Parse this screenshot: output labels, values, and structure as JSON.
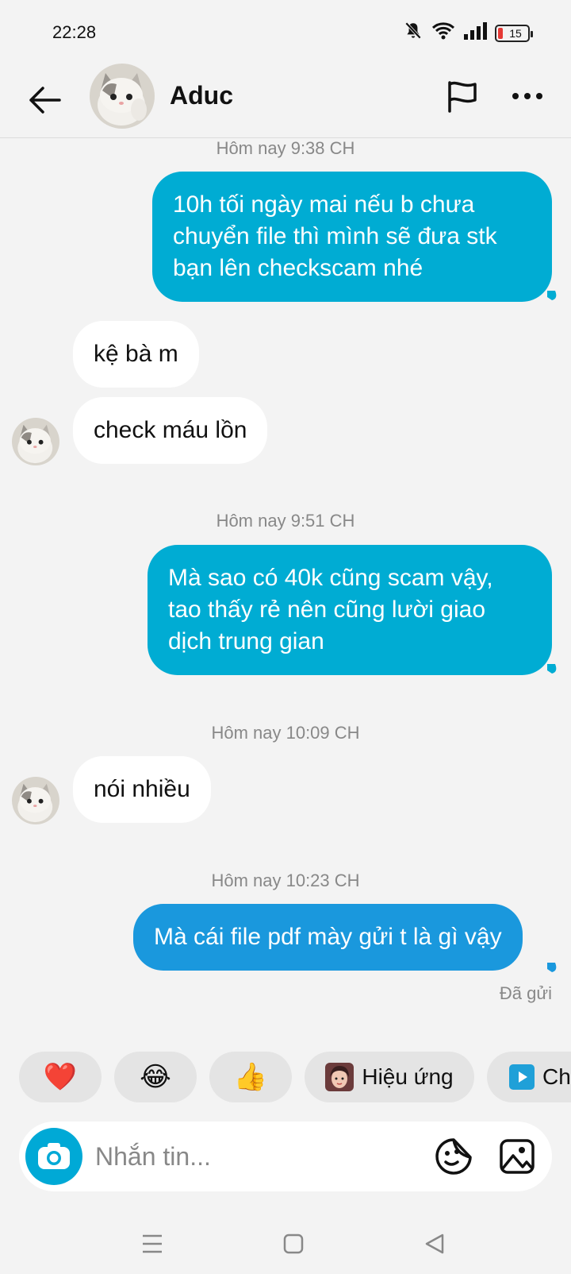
{
  "status_bar": {
    "time": "22:28",
    "battery": "15"
  },
  "header": {
    "contact_name": "Aduc"
  },
  "messages": [
    {
      "timestamp": "Hôm nay 9:38 CH"
    },
    {
      "direction": "out",
      "text": "10h tối ngày mai nếu b chưa chuyển file thì mình sẽ đưa stk bạn lên checkscam nhé"
    },
    {
      "direction": "in",
      "text": "kệ bà m"
    },
    {
      "direction": "in",
      "text": "check máu lồn"
    },
    {
      "timestamp": "Hôm nay 9:51 CH"
    },
    {
      "direction": "out",
      "text": "Mà sao có 40k cũng scam vậy, tao thấy rẻ nên cũng lười giao dịch trung gian"
    },
    {
      "timestamp": "Hôm nay 10:09 CH"
    },
    {
      "direction": "in",
      "text": "nói nhiều"
    },
    {
      "timestamp": "Hôm nay 10:23 CH"
    },
    {
      "direction": "out",
      "text": "Mà cái file pdf mày gửi t là gì vậy"
    },
    {
      "status": "Đã gửi"
    }
  ],
  "quick_reactions": [
    {
      "emoji": "❤️",
      "icon": "heart-icon"
    },
    {
      "emoji": "😂",
      "icon": "laughing-face-icon"
    },
    {
      "emoji": "👍",
      "icon": "thumbs-up-icon"
    },
    {
      "label": "Hiệu ứng",
      "icon": "effects-avatar-icon"
    },
    {
      "label": "Ch",
      "icon": "play-icon"
    }
  ],
  "composer": {
    "placeholder": "Nhắn tin..."
  },
  "colors": {
    "outgoing_bubble": "#00acd3",
    "outgoing_bubble_last": "#1a98dd",
    "incoming_bubble": "#ffffff",
    "camera_button": "#00a9d6"
  }
}
